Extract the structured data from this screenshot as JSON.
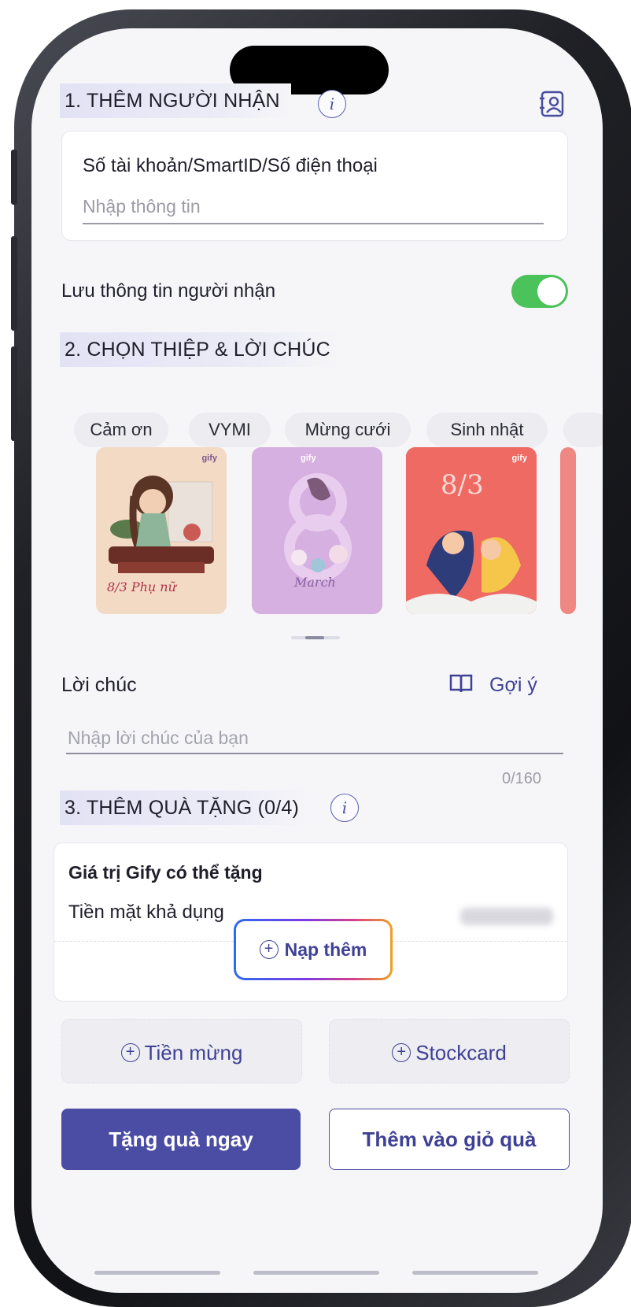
{
  "recipient": {
    "section_title": "1. THÊM NGƯỜI NHẬN",
    "field_label": "Số tài khoản/SmartID/Số điện thoại",
    "field_placeholder": "Nhập thông tin",
    "save_label": "Lưu thông tin người nhận",
    "save_enabled": true
  },
  "card_section": {
    "section_title": "2. CHỌN THIỆP & LỜI CHÚC",
    "categories": [
      "Cảm ơn",
      "VYMI",
      "Mừng cưới",
      "Sinh nhật"
    ],
    "cards": [
      {
        "brand": "gify",
        "caption": "8/3 Phụ nữ"
      },
      {
        "brand": "gify",
        "caption": "March"
      },
      {
        "brand": "gify",
        "caption": "8/3"
      }
    ],
    "message_label": "Lời chúc",
    "suggest_label": "Gợi ý",
    "message_placeholder": "Nhập lời chúc của bạn",
    "char_counter": "0/160"
  },
  "gift_section": {
    "section_title": "3. THÊM QUÀ TẶNG (0/4)",
    "balance_title": "Giá trị Gify có thể tặng",
    "cash_label": "Tiền mặt khả dụng",
    "cash_value_hidden": "blurred",
    "topup_label": "Nạp thêm",
    "lucky_money_label": "Tiền mừng",
    "stockcard_label": "Stockcard"
  },
  "actions": {
    "gift_now": "Tặng quà ngay",
    "add_to_cart": "Thêm vào giỏ quà"
  },
  "colors": {
    "primary": "#4b4da4",
    "toggle_on": "#4cc25a",
    "screen_bg": "#f6f6f9"
  },
  "icons": [
    "info-icon",
    "contact-book-icon",
    "toggle-switch",
    "open-book-icon",
    "plus-circle-icon"
  ]
}
